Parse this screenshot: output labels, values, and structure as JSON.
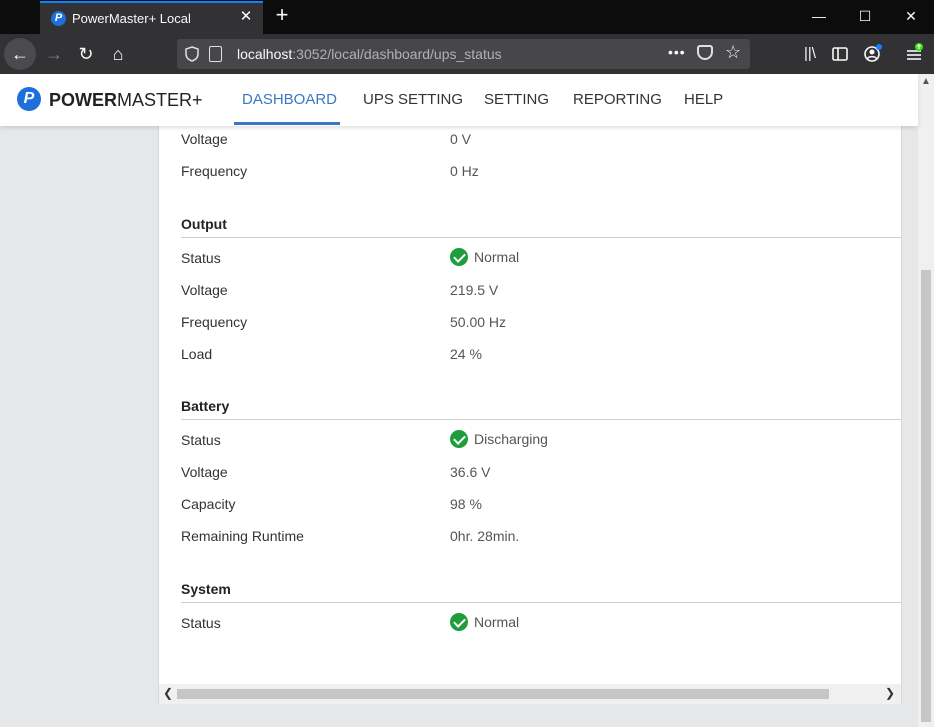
{
  "browser": {
    "tab_title": "PowerMaster+ Local",
    "tab_favicon_letter": "P",
    "tab_close": "✕",
    "new_tab": "+",
    "url_host": "localhost",
    "url_rest": ":3052/local/dashboard/ups_status",
    "url_more": "•••",
    "window_controls": {
      "minimize": "—",
      "maximize": "☐",
      "close": "✕"
    }
  },
  "app": {
    "logo_letter": "P",
    "logo_bold": "POWER",
    "logo_rest": "MASTER+",
    "nav": [
      "DASHBOARD",
      "UPS SETTING",
      "SETTING",
      "REPORTING",
      "HELP"
    ],
    "active_nav": "DASHBOARD",
    "accent_color": "#3b78c3"
  },
  "status": {
    "input_partial": [
      {
        "label": "Voltage",
        "value": "0 V"
      },
      {
        "label": "Frequency",
        "value": "0 Hz"
      }
    ],
    "output": {
      "title": "Output",
      "rows": [
        {
          "label": "Status",
          "value": "Normal",
          "icon": "check-circle-icon"
        },
        {
          "label": "Voltage",
          "value": "219.5 V"
        },
        {
          "label": "Frequency",
          "value": "50.00 Hz"
        },
        {
          "label": "Load",
          "value": "24 %"
        }
      ]
    },
    "battery": {
      "title": "Battery",
      "rows": [
        {
          "label": "Status",
          "value": "Discharging",
          "icon": "check-circle-icon"
        },
        {
          "label": "Voltage",
          "value": "36.6 V"
        },
        {
          "label": "Capacity",
          "value": "98 %"
        },
        {
          "label": "Remaining Runtime",
          "value": "0hr. 28min."
        }
      ]
    },
    "system": {
      "title": "System",
      "rows": [
        {
          "label": "Status",
          "value": "Normal",
          "icon": "check-circle-icon"
        }
      ]
    },
    "status_ok_color": "#1e9e3b"
  }
}
